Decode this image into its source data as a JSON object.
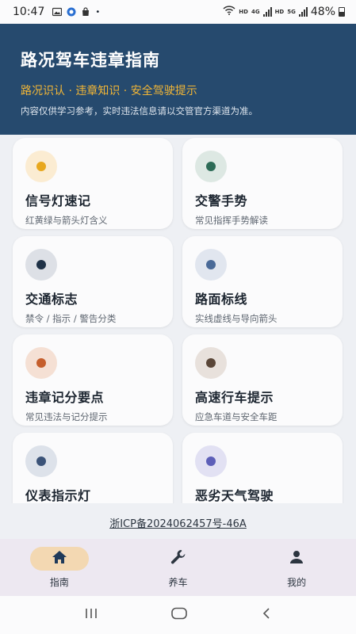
{
  "status_bar": {
    "time": "10:47",
    "network_labels": [
      "HD",
      "4G",
      "HD",
      "5G"
    ],
    "battery": "48%"
  },
  "header": {
    "title": "路况驾车违章指南",
    "subtitle": "路况识认 · 违章知识 · 安全驾驶提示",
    "note": "内容仅供学习参考，实时违法信息请以交管官方渠道为准。"
  },
  "cards": [
    {
      "title": "信号灯速记",
      "desc": "红黄绿与箭头灯含义",
      "circle_color": "#fbecd2",
      "dot_color": "#e8a81e",
      "icon": "traffic-light-icon"
    },
    {
      "title": "交警手势",
      "desc": "常见指挥手势解读",
      "circle_color": "#dde8e3",
      "dot_color": "#2d6b57",
      "icon": "police-gesture-icon"
    },
    {
      "title": "交通标志",
      "desc": "禁令 / 指示 / 警告分类",
      "circle_color": "#dde0e6",
      "dot_color": "#1f3247",
      "icon": "traffic-sign-icon"
    },
    {
      "title": "路面标线",
      "desc": "实线虚线与导向箭头",
      "circle_color": "#e1e6ef",
      "dot_color": "#4a6a98",
      "icon": "road-marking-icon"
    },
    {
      "title": "违章记分要点",
      "desc": "常见违法与记分提示",
      "circle_color": "#f5e0d4",
      "dot_color": "#c55e2c",
      "icon": "violation-points-icon"
    },
    {
      "title": "高速行车提示",
      "desc": "应急车道与安全车距",
      "circle_color": "#e8e1dc",
      "dot_color": "#5a4638",
      "icon": "highway-icon"
    },
    {
      "title": "仪表指示灯",
      "desc": "",
      "circle_color": "#dde2ea",
      "dot_color": "#3b5378",
      "icon": "dashboard-light-icon"
    },
    {
      "title": "恶劣天气驾驶",
      "desc": "",
      "circle_color": "#e2e1f3",
      "dot_color": "#5d5fb8",
      "icon": "bad-weather-icon"
    }
  ],
  "icp": "浙ICP备2024062457号-46A",
  "nav": {
    "items": [
      {
        "label": "指南",
        "icon": "home-icon",
        "active": true
      },
      {
        "label": "养车",
        "icon": "wrench-icon",
        "active": false
      },
      {
        "label": "我的",
        "icon": "person-icon",
        "active": false
      }
    ]
  },
  "colors": {
    "header_bg": "#264a6e",
    "subtitle": "#f2b636",
    "active_nav_pill": "#f3d8b2",
    "nav_bg": "#ede8f1"
  }
}
